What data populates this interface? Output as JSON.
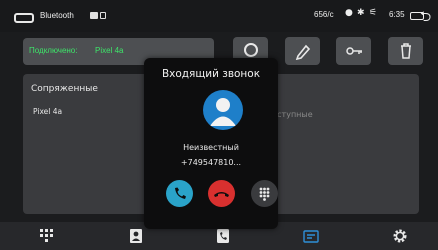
{
  "status_bar": {
    "app_title": "Bluetooth",
    "speed": "656/с",
    "time": "6:35"
  },
  "connection": {
    "status_label": "Подключено:",
    "device_name": "Pixel 4a"
  },
  "toolbar": {
    "buttons": [
      "search",
      "edit",
      "key",
      "delete"
    ]
  },
  "paired_devices": {
    "title": "Сопряженные",
    "items": [
      "Pixel 4a"
    ],
    "available_label": "Доступные"
  },
  "incoming_call": {
    "title": "Входящий звонок",
    "caller_name": "Неизвестный",
    "caller_number": "+749547810...",
    "accept_color": "#2aa3c9",
    "decline_color": "#d8302f",
    "keypad_color": "#3a3b3e"
  },
  "dock": {
    "items": [
      "dialpad",
      "contacts",
      "call-log",
      "bluetooth-music",
      "settings"
    ],
    "active_color": "#2f8fd8"
  }
}
